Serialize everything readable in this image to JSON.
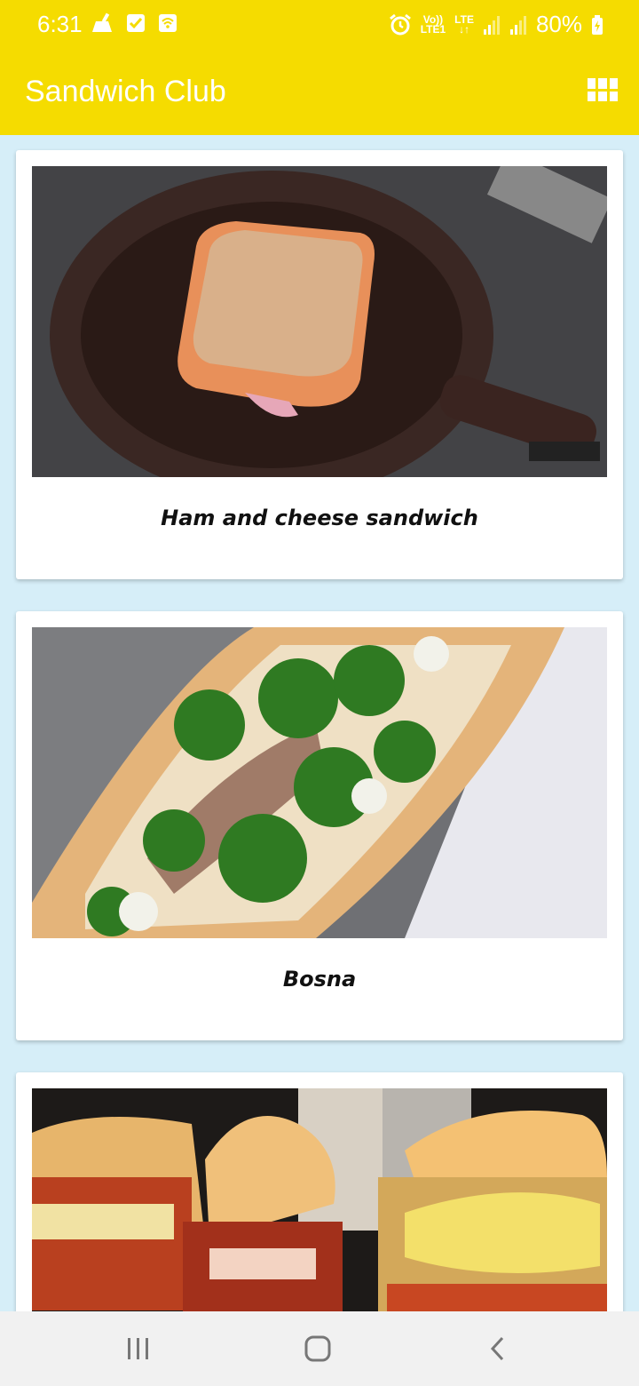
{
  "status_bar": {
    "time": "6:31",
    "volte_top": "Vo))",
    "volte_bottom": "LTE1",
    "lte_top": "LTE",
    "lte_bottom": "↓↑",
    "battery": "80%"
  },
  "app_bar": {
    "title": "Sandwich Club",
    "grid_icon": "grid-view-icon"
  },
  "cards": [
    {
      "title": "Ham and cheese sandwich"
    },
    {
      "title": "Bosna"
    },
    {
      "title": ""
    }
  ],
  "nav_bar": {
    "icons": [
      "recent-apps-icon",
      "home-icon",
      "back-icon"
    ]
  },
  "colors": {
    "app_bar": "#f5dc00",
    "background": "#d6eef8",
    "card": "#ffffff",
    "nav_bar": "#f1f1f1"
  }
}
